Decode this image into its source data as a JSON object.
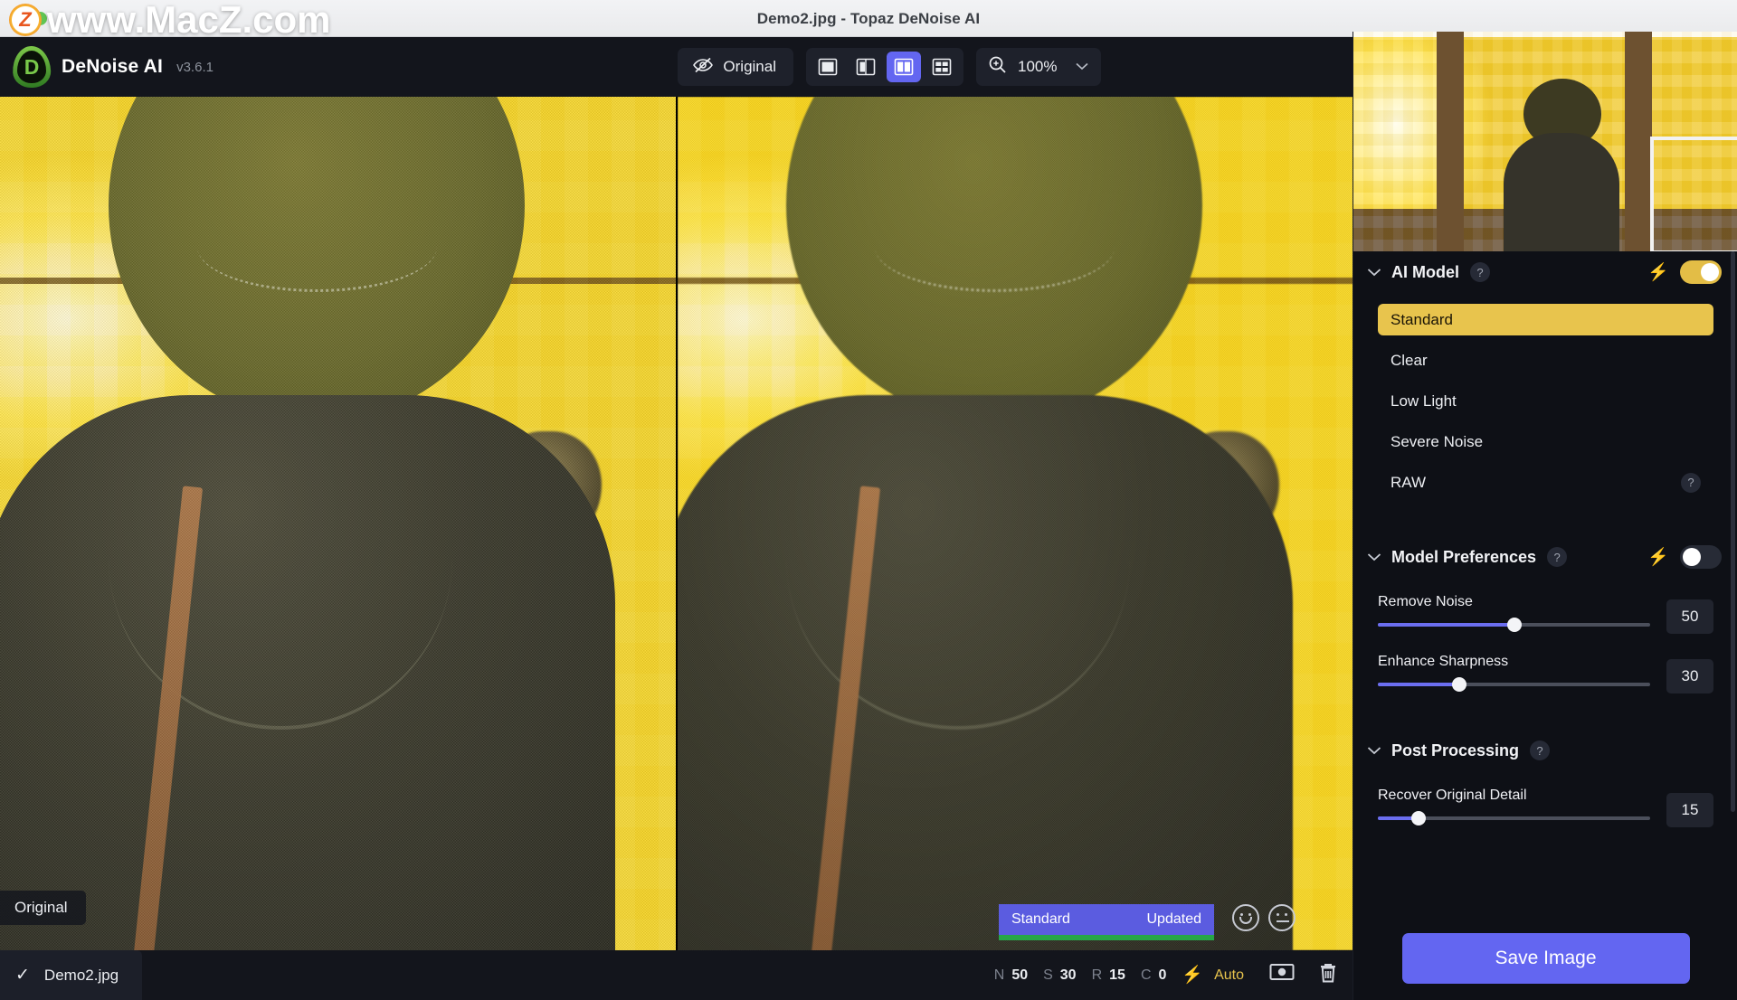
{
  "window": {
    "title": "Demo2.jpg - Topaz DeNoise AI",
    "watermark": "www.MacZ.com",
    "watermark_logo_letter": "Z"
  },
  "toolbar": {
    "brand_letter": "D",
    "brand_name": "DeNoise AI",
    "version": "v3.6.1",
    "original_button": {
      "label": "Original",
      "icon": "eye-slash-icon"
    },
    "view_modes": [
      {
        "name": "single-view",
        "icon": "single-pane-icon",
        "active": false
      },
      {
        "name": "split-view",
        "icon": "two-pane-icon",
        "active": false
      },
      {
        "name": "side-by-side-view",
        "icon": "two-pane-wide-icon",
        "active": true
      },
      {
        "name": "quad-view",
        "icon": "four-pane-icon",
        "active": false
      }
    ],
    "zoom": {
      "icon": "magnifier-plus-icon",
      "level": "100%",
      "caret": "chevron-down-icon"
    }
  },
  "canvas": {
    "left_label": "Original",
    "compare_badge": {
      "model": "Standard",
      "status": "Updated"
    },
    "feedback": [
      {
        "name": "thumbs-happy-face-icon"
      },
      {
        "name": "thumbs-neutral-face-icon"
      }
    ]
  },
  "panel": {
    "ai_model": {
      "title": "AI Model",
      "help": "?",
      "auto_icon": "lightning-bolt-icon",
      "toggle_on": true,
      "chevron": "chevron-down-icon",
      "models": [
        {
          "label": "Standard",
          "selected": true,
          "help": null
        },
        {
          "label": "Clear",
          "selected": false,
          "help": null
        },
        {
          "label": "Low Light",
          "selected": false,
          "help": null
        },
        {
          "label": "Severe Noise",
          "selected": false,
          "help": null
        },
        {
          "label": "RAW",
          "selected": false,
          "help": "?"
        }
      ]
    },
    "model_preferences": {
      "title": "Model Preferences",
      "help": "?",
      "auto_icon": "lightning-bolt-icon",
      "toggle_on": false,
      "chevron": "chevron-down-icon",
      "sliders": [
        {
          "label": "Remove Noise",
          "value": "50",
          "percent": 50
        },
        {
          "label": "Enhance Sharpness",
          "value": "30",
          "percent": 30
        }
      ]
    },
    "post_processing": {
      "title": "Post Processing",
      "help": "?",
      "chevron": "chevron-down-icon",
      "sliders": [
        {
          "label": "Recover Original Detail",
          "value": "15",
          "percent": 15
        }
      ]
    },
    "save_button": "Save Image"
  },
  "statusbar": {
    "check_icon": "checkmark-icon",
    "filename": "Demo2.jpg",
    "stats": [
      {
        "key": "N",
        "value": "50"
      },
      {
        "key": "S",
        "value": "30"
      },
      {
        "key": "R",
        "value": "15"
      },
      {
        "key": "C",
        "value": "0"
      }
    ],
    "auto_icon": "lightning-bolt-icon",
    "auto_label": "Auto",
    "icons": [
      {
        "name": "preview-image-icon"
      },
      {
        "name": "trash-icon"
      }
    ]
  },
  "colors": {
    "accent_purple": "#6366f1",
    "accent_gold": "#e8c44d",
    "green_bar": "#27a648",
    "panel_bg": "#0e1016",
    "toolbar_bg": "#13151c"
  }
}
